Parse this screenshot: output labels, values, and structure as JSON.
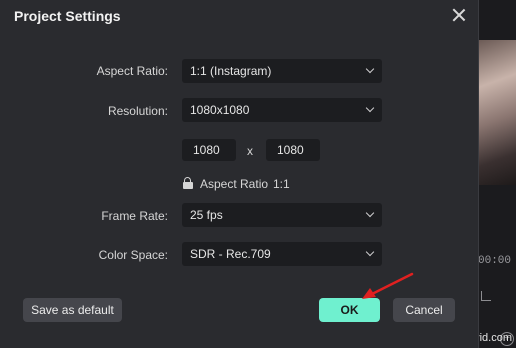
{
  "dialog": {
    "title": "Project Settings",
    "close_icon": "close-icon"
  },
  "fields": {
    "aspect_ratio": {
      "label": "Aspect Ratio:",
      "value": "1:1 (Instagram)"
    },
    "resolution": {
      "label": "Resolution:",
      "value": "1080x1080"
    },
    "width": "1080",
    "separator": "x",
    "height": "1080",
    "aspect_lock": {
      "icon": "unlock-icon",
      "label": "Aspect Ratio",
      "value": "1:1"
    },
    "frame_rate": {
      "label": "Frame Rate:",
      "value": "25 fps"
    },
    "color_space": {
      "label": "Color Space:",
      "value": "SDR - Rec.709"
    }
  },
  "buttons": {
    "save_default": "Save as default",
    "ok": "OK",
    "cancel": "Cancel"
  },
  "background": {
    "timecode": "00:00",
    "watermark": "www.wvid.com"
  },
  "annotation": {
    "arrow_color": "#e02020"
  },
  "colors": {
    "accent": "#6ff0cf",
    "dialog_bg": "#2a2b2f",
    "field_bg": "#1c1d20"
  }
}
